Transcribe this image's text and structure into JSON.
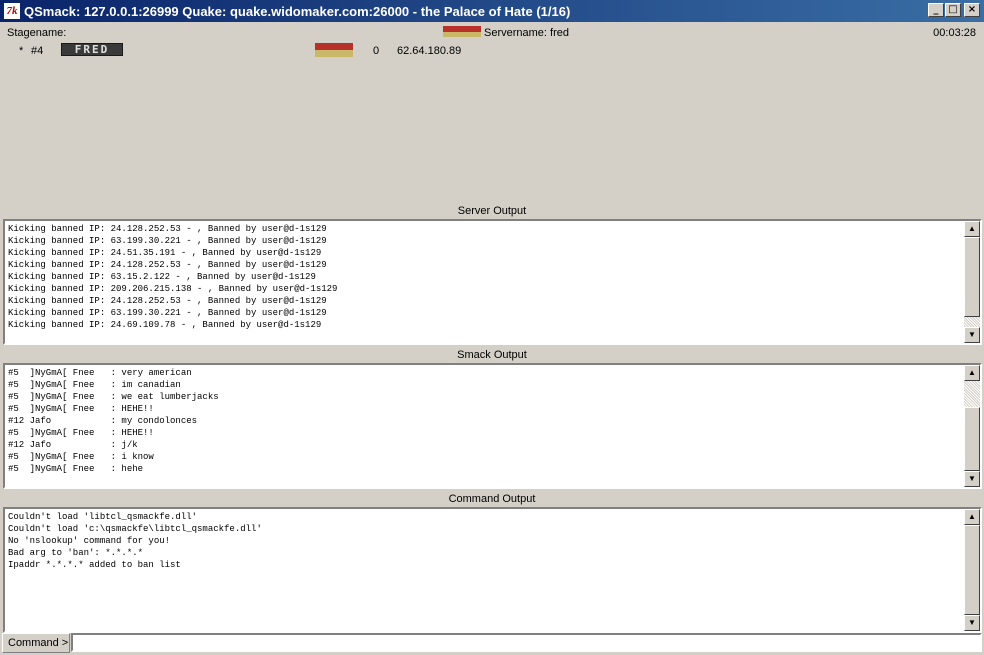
{
  "window": {
    "icon_text": "7k",
    "title": "QSmack: 127.0.0.1:26999 Quake: quake.widomaker.com:26000 - the Palace of Hate (1/16)",
    "minimize": "_",
    "maximize": "□",
    "close": "×"
  },
  "status": {
    "stagename_label": "Stagename:",
    "servername_label": "Servername: fred",
    "elapsed": "00:03:28",
    "server_colors": {
      "top": "#b8302a",
      "bottom": "#c8b868"
    }
  },
  "players": [
    {
      "marker": "*",
      "slot": "#4",
      "name": "FRED",
      "colors": {
        "top": "#b8302a",
        "bottom": "#c8b868"
      },
      "frags": "0",
      "ip": "62.64.180.89"
    }
  ],
  "server_output": {
    "label": "Server Output",
    "lines": [
      "Kicking banned IP: 24.128.252.53 - , Banned by user@d-1s129",
      "Kicking banned IP: 63.199.30.221 - , Banned by user@d-1s129",
      "Kicking banned IP: 24.51.35.191 - , Banned by user@d-1s129",
      "Kicking banned IP: 24.128.252.53 - , Banned by user@d-1s129",
      "Kicking banned IP: 63.15.2.122 - , Banned by user@d-1s129",
      "Kicking banned IP: 209.206.215.138 - , Banned by user@d-1s129",
      "Kicking banned IP: 24.128.252.53 - , Banned by user@d-1s129",
      "Kicking banned IP: 63.199.30.221 - , Banned by user@d-1s129",
      "Kicking banned IP: 24.69.109.78 - , Banned by user@d-1s129"
    ]
  },
  "smack_output": {
    "label": "Smack Output",
    "lines": [
      "#5  ]NyGmA[ Fnee   : very american",
      "#5  ]NyGmA[ Fnee   : im canadian",
      "#5  ]NyGmA[ Fnee   : we eat lumberjacks",
      "#5  ]NyGmA[ Fnee   : HEHE!!",
      "#12 Jafo           : my condolonces",
      "#5  ]NyGmA[ Fnee   : HEHE!!",
      "#12 Jafo           : j/k",
      "#5  ]NyGmA[ Fnee   : i know",
      "#5  ]NyGmA[ Fnee   : hehe"
    ]
  },
  "command_output": {
    "label": "Command Output",
    "lines": [
      "Couldn't load 'libtcl_qsmackfe.dll'",
      "Couldn't load 'c:\\qsmackfe\\libtcl_qsmackfe.dll'",
      "No 'nslookup' command for you!",
      "Bad arg to 'ban': *.*.*.*",
      "Ipaddr *.*.*.* added to ban list"
    ]
  },
  "command_line": {
    "label": "Command >",
    "value": ""
  },
  "scroll_arrows": {
    "up": "▲",
    "down": "▼"
  }
}
